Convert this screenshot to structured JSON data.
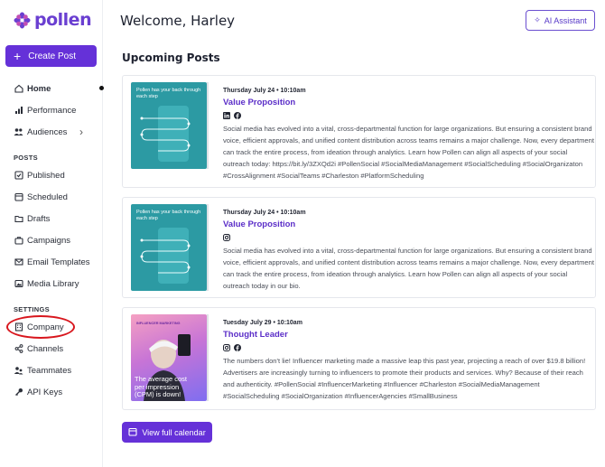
{
  "app": {
    "name": "pollen"
  },
  "colors": {
    "brand": "#6531d8",
    "accent_text": "#5b2ec8",
    "annotation": "#d8161d"
  },
  "sidebar": {
    "create_label": "Create Post",
    "main_items": [
      {
        "label": "Home",
        "icon": "home-icon"
      },
      {
        "label": "Performance",
        "icon": "bar-chart-icon"
      },
      {
        "label": "Audiences",
        "icon": "people-icon"
      }
    ],
    "posts_section": "POSTS",
    "post_items": [
      {
        "label": "Published",
        "icon": "checkbox-icon"
      },
      {
        "label": "Scheduled",
        "icon": "calendar-icon"
      },
      {
        "label": "Drafts",
        "icon": "folder-icon"
      },
      {
        "label": "Campaigns",
        "icon": "briefcase-icon"
      },
      {
        "label": "Email Templates",
        "icon": "mail-icon"
      },
      {
        "label": "Media Library",
        "icon": "image-icon"
      }
    ],
    "settings_section": "SETTINGS",
    "settings_items": [
      {
        "label": "Company",
        "icon": "building-icon"
      },
      {
        "label": "Channels",
        "icon": "share-icon"
      },
      {
        "label": "Teammates",
        "icon": "people-icon"
      },
      {
        "label": "API Keys",
        "icon": "key-icon"
      }
    ]
  },
  "header": {
    "welcome": "Welcome, Harley",
    "ai_label": "AI Assistant"
  },
  "main": {
    "heading": "Upcoming Posts",
    "posts": [
      {
        "date": "Thursday July 24 • 10:10am",
        "title": "Value Proposition",
        "channels": [
          "linkedin-icon",
          "facebook-icon"
        ],
        "thumb_text": "Pollen has your back through each step",
        "body": "Social media has evolved into a vital, cross-departmental function for large organizations. But ensuring a consistent brand voice, efficient approvals, and unified content distribution across teams remains a major challenge. Now, every department can track the entire process, from ideation through analytics. Learn how Pollen can align all aspects of your social outreach today: https://bit.ly/3ZXQd2i #PollenSocial #SocialMediaManagement #SocialScheduling #SocialOrganizaton #CrossAlignment #SocialTeams #Charleston #PlatformScheduling"
      },
      {
        "date": "Thursday July 24 • 10:10am",
        "title": "Value Proposition",
        "channels": [
          "instagram-icon"
        ],
        "thumb_text": "Pollen has your back through each step",
        "body": "Social media has evolved into a vital, cross-departmental function for large organizations. But ensuring a consistent brand voice, efficient approvals, and unified content distribution across teams remains a major challenge. Now, every department can track the entire process, from ideation through analytics. Learn how Pollen can align all aspects of your social outreach today in our bio."
      },
      {
        "date": "Tuesday July 29 • 10:10am",
        "title": "Thought Leader",
        "channels": [
          "instagram-icon",
          "facebook-icon"
        ],
        "thumb_label": "INFLUENCER MARKETING",
        "thumb_text": "The average cost per impression (CPM) is down!",
        "body": "The numbers don't lie! Influencer marketing made a massive leap this past year, projecting a reach of over $19.8 billion! Advertisers are increasingly turning to influencers to promote their products and services. Why? Because of their reach and authenticity. #PollenSocial #InfluencerMarketing #Influencer #Charleston #SocialMediaManagement #SocialScheduling #SocialOrganization #InfluencerAgencies #SmallBusiness"
      }
    ],
    "calendar_label": "View full calendar"
  }
}
